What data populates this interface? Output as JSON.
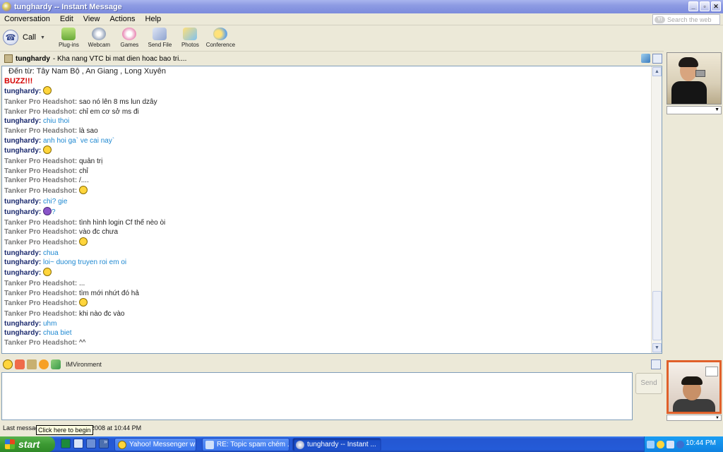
{
  "window": {
    "title": "tunghardy -- Instant Message"
  },
  "menu": [
    "Conversation",
    "Edit",
    "View",
    "Actions",
    "Help"
  ],
  "search": {
    "placeholder": "Search the web"
  },
  "toolbar": {
    "call_label": "Call",
    "buttons": [
      "Plug-ins",
      "Webcam",
      "Games",
      "Send File",
      "Photos",
      "Conference"
    ]
  },
  "status": {
    "buddy": "tunghardy",
    "message": "- Kha nang VTC bi mat dien hoac bao tri...."
  },
  "chat": {
    "intro": "Đến từ: Tây Nam Bộ , An Giang , Long Xuyên",
    "buzz": "BUZZ!!!",
    "messages": [
      {
        "sender": "tunghardy:",
        "text": "",
        "emo": "grin",
        "me": true
      },
      {
        "sender": "Tanker Pro Headshot:",
        "text": "sao nó lên 8 ms lun dzây",
        "me": false
      },
      {
        "sender": "Tanker Pro Headshot:",
        "text": "chỉ em cơ sở ms đi",
        "me": false
      },
      {
        "sender": "tunghardy:",
        "text": "chiu thoi",
        "me": true
      },
      {
        "sender": "Tanker Pro Headshot:",
        "text": "là sao",
        "me": false
      },
      {
        "sender": "tunghardy:",
        "text": "anh hoi ga` ve cai nay`",
        "me": true
      },
      {
        "sender": "tunghardy:",
        "text": "",
        "emo": "wink",
        "me": true
      },
      {
        "sender": "Tanker Pro Headshot:",
        "text": "quản trị",
        "me": false
      },
      {
        "sender": "Tanker Pro Headshot:",
        "text": "chỉ",
        "me": false
      },
      {
        "sender": "Tanker Pro Headshot:",
        "text": "/....",
        "me": false
      },
      {
        "sender": "Tanker Pro Headshot:",
        "text": "",
        "emo": "cool",
        "me": false
      },
      {
        "sender": "tunghardy:",
        "text": "chi? gie",
        "me": true
      },
      {
        "sender": "tunghardy:",
        "text": "?",
        "emo": "devil",
        "me": true
      },
      {
        "sender": "Tanker Pro Headshot:",
        "text": "tình hình login Cf thế nèo òi",
        "me": false
      },
      {
        "sender": "Tanker Pro Headshot:",
        "text": "vào đc chưa",
        "me": false
      },
      {
        "sender": "Tanker Pro Headshot:",
        "text": "",
        "emo": "sleepy",
        "me": false
      },
      {
        "sender": "tunghardy:",
        "text": "chua",
        "me": true
      },
      {
        "sender": "tunghardy:",
        "text": "loi~ duong truyen roi em oi",
        "me": true
      },
      {
        "sender": "tunghardy:",
        "text": "",
        "emo": "sad",
        "me": true
      },
      {
        "sender": "Tanker Pro Headshot:",
        "text": "...",
        "me": false
      },
      {
        "sender": "Tanker Pro Headshot:",
        "text": "tìm mới nhứt đó hả",
        "me": false
      },
      {
        "sender": "Tanker Pro Headshot:",
        "text": "",
        "emo": "surprised",
        "me": false
      },
      {
        "sender": "Tanker Pro Headshot:",
        "text": "khi nào đc vào",
        "me": false
      },
      {
        "sender": "tunghardy:",
        "text": "uhm",
        "me": true
      },
      {
        "sender": "tunghardy:",
        "text": "chua biet",
        "me": true
      },
      {
        "sender": "Tanker Pro Headshot:",
        "text": "^^",
        "me": false
      }
    ]
  },
  "composer": {
    "imvironment_label": "IMVironment",
    "send_label": "Send"
  },
  "footer": {
    "last_message_prefix": "Last messag",
    "last_message_suffix": "2008 at 10:44 PM",
    "tooltip": "Click here to begin"
  },
  "taskbar": {
    "start_label": "start",
    "tasks": [
      {
        "label": "Yahoo! Messenger wi...",
        "active": false
      },
      {
        "label": "RE: Topic spam chém ...",
        "active": false
      },
      {
        "label": "tunghardy -- Instant ...",
        "active": true
      }
    ],
    "clock": "10:44 PM"
  },
  "colors": {
    "me_sender": "#1b2a6e",
    "me_text": "#1e88d1",
    "other_sender": "#7a7a7a",
    "buzz": "#d40000",
    "taskbar": "#245bd8",
    "start_green": "#3c9a33"
  }
}
